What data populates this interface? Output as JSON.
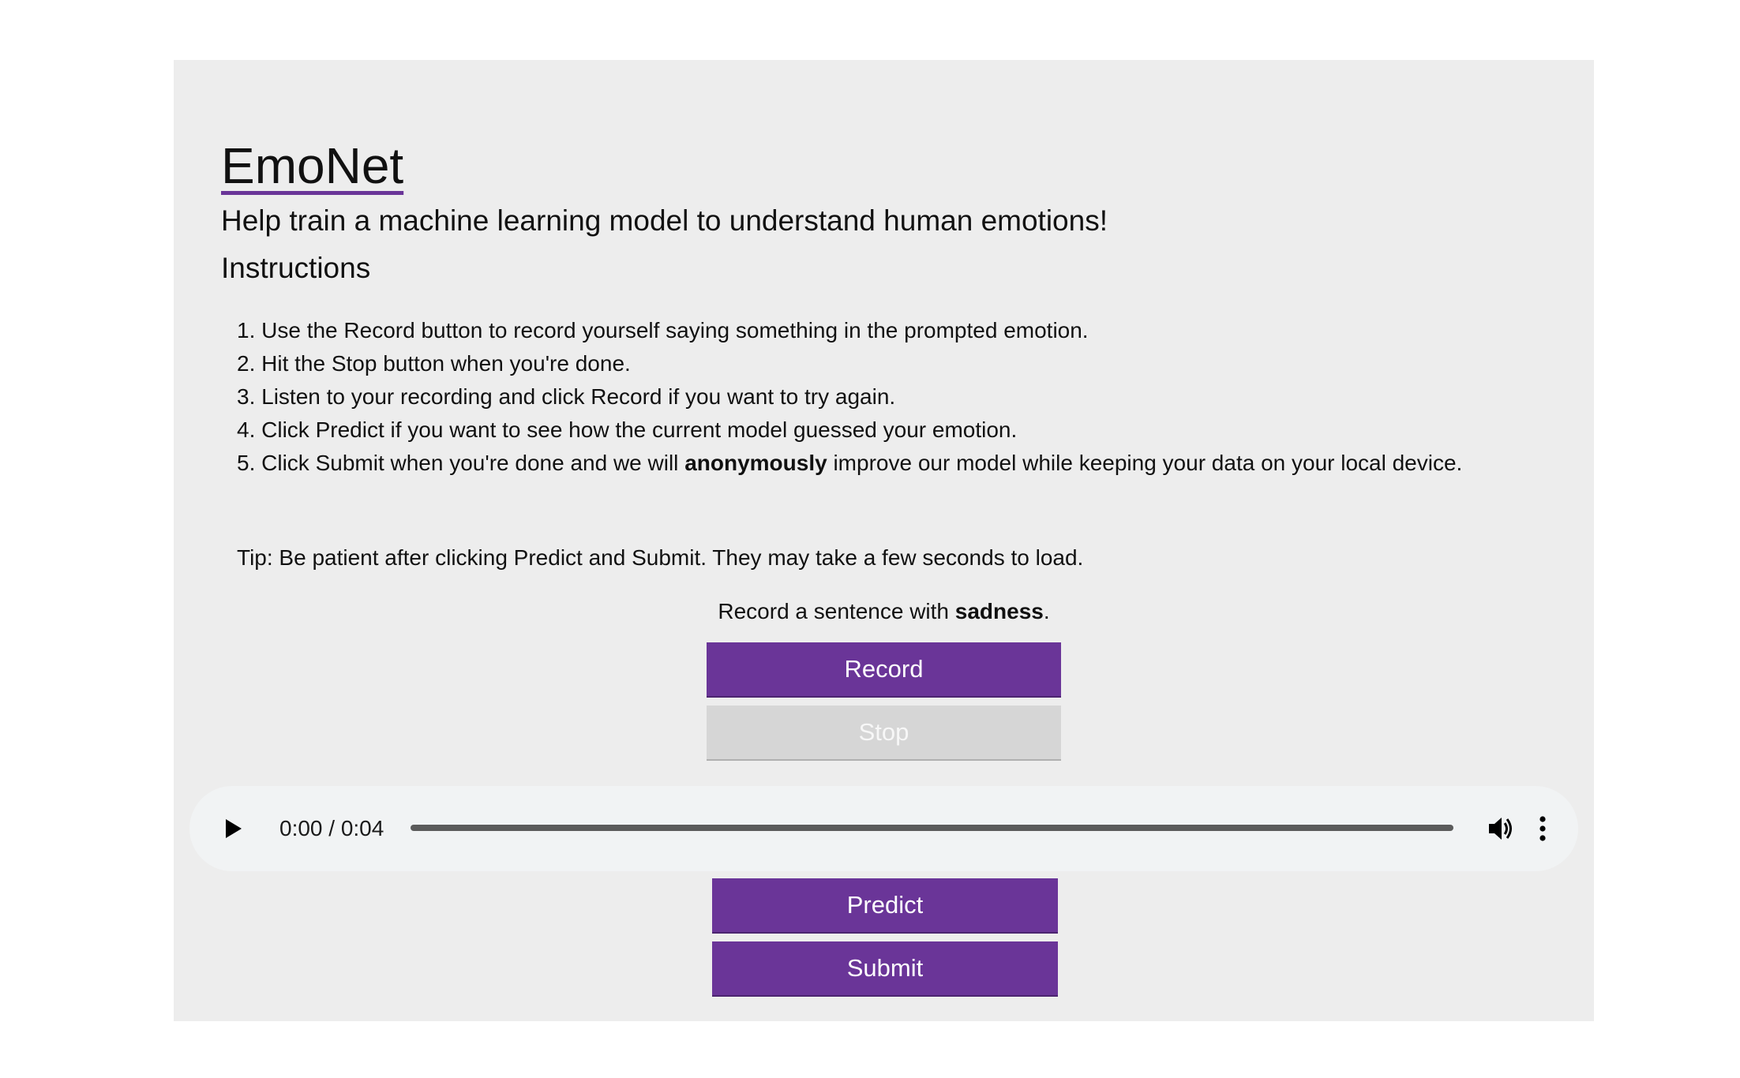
{
  "app": {
    "title": "EmoNet",
    "tagline": "Help train a machine learning model to understand human emotions!"
  },
  "instructions": {
    "heading": "Instructions",
    "steps": [
      "1. Use the Record button to record yourself saying something in the prompted emotion.",
      "2. Hit the Stop button when you're done.",
      "3. Listen to your recording and click Record if you want to try again.",
      "4. Click Predict if you want to see how the current model guessed your emotion."
    ],
    "step5": {
      "before": "5. Click Submit when you're done and we will ",
      "bold": "anonymously",
      "after": " improve our model while keeping your data on your local device."
    },
    "tip": "Tip: Be patient after clicking Predict and Submit. They may take a few seconds to load."
  },
  "prompt": {
    "before": "Record a sentence with ",
    "emotion": "sadness",
    "after": "."
  },
  "buttons": {
    "record": "Record",
    "stop": "Stop",
    "predict": "Predict",
    "submit": "Submit"
  },
  "audio_player": {
    "time_display": "0:00 / 0:04",
    "current_time": "0:00",
    "duration": "0:04",
    "progress": 0,
    "icons": [
      "play-icon",
      "volume-icon",
      "more-options-icon"
    ]
  },
  "colors": {
    "accent": "#6a3598",
    "panel_background": "#ededed",
    "disabled_button": "#d6d6d6",
    "player_background": "#f1f3f4"
  }
}
